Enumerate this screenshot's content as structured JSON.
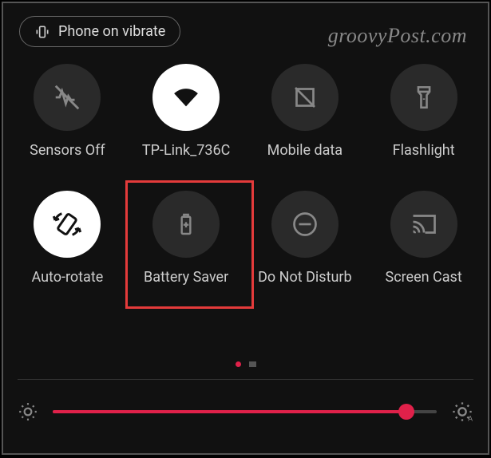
{
  "chip": {
    "label": "Phone on vibrate"
  },
  "watermark": "groovyPost.com",
  "tiles": [
    {
      "label": "Sensors Off",
      "active": false
    },
    {
      "label": "TP-Link_736C",
      "active": true
    },
    {
      "label": "Mobile data",
      "active": false
    },
    {
      "label": "Flashlight",
      "active": false
    },
    {
      "label": "Auto-rotate",
      "active": true
    },
    {
      "label": "Battery Saver",
      "active": false
    },
    {
      "label": "Do Not Disturb",
      "active": false
    },
    {
      "label": "Screen Cast",
      "active": false
    }
  ],
  "highlighted_tile_index": 5,
  "brightness": {
    "percent": 92
  },
  "pager": {
    "current": 0,
    "total": 2
  },
  "colors": {
    "accent": "#e0214a",
    "highlight": "#e43b3b"
  }
}
